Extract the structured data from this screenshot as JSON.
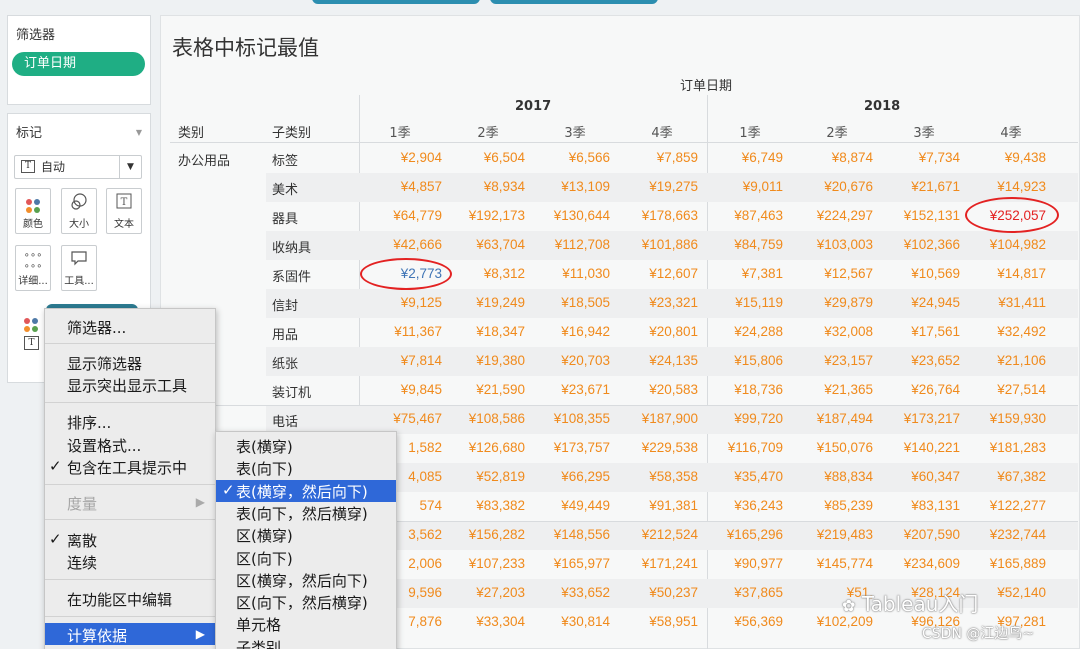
{
  "filters": {
    "title": "筛选器",
    "pill": "订单日期"
  },
  "marks": {
    "title": "标记",
    "type": "自动",
    "buttons": [
      {
        "label": "颜色",
        "icon": "color-dots-icon"
      },
      {
        "label": "大小",
        "icon": "size-icon"
      },
      {
        "label": "文本",
        "icon": "text-icon"
      },
      {
        "label": "详细...",
        "icon": "detail-icon"
      },
      {
        "label": "工具...",
        "icon": "tooltip-icon"
      }
    ]
  },
  "viz": {
    "title": "表格中标记最值",
    "column_header": "订单日期",
    "years": [
      "2017",
      "2018"
    ],
    "row_header_1": "类别",
    "row_header_2": "子类别",
    "quarters": [
      "1季",
      "2季",
      "3季",
      "4季",
      "1季",
      "2季",
      "3季",
      "4季"
    ],
    "category": "办公用品",
    "rows": [
      {
        "sub": "标签",
        "values": [
          "¥2,904",
          "¥6,504",
          "¥6,566",
          "¥7,859",
          "¥6,749",
          "¥8,874",
          "¥7,734",
          "¥9,438"
        ]
      },
      {
        "sub": "美术",
        "values": [
          "¥4,857",
          "¥8,934",
          "¥13,109",
          "¥19,275",
          "¥9,011",
          "¥20,676",
          "¥21,671",
          "¥14,923"
        ]
      },
      {
        "sub": "器具",
        "values": [
          "¥64,779",
          "¥192,173",
          "¥130,644",
          "¥178,663",
          "¥87,463",
          "¥224,297",
          "¥152,131",
          "¥252,057"
        ]
      },
      {
        "sub": "收纳具",
        "values": [
          "¥42,666",
          "¥63,704",
          "¥112,708",
          "¥101,886",
          "¥84,759",
          "¥103,003",
          "¥102,366",
          "¥104,982"
        ]
      },
      {
        "sub": "系固件",
        "values": [
          "¥2,773",
          "¥8,312",
          "¥11,030",
          "¥12,607",
          "¥7,381",
          "¥12,567",
          "¥10,569",
          "¥14,817"
        ]
      },
      {
        "sub": "信封",
        "values": [
          "¥9,125",
          "¥19,249",
          "¥18,505",
          "¥23,321",
          "¥15,119",
          "¥29,879",
          "¥24,945",
          "¥31,411"
        ]
      },
      {
        "sub": "用品",
        "values": [
          "¥11,367",
          "¥18,347",
          "¥16,942",
          "¥20,801",
          "¥24,288",
          "¥32,008",
          "¥17,561",
          "¥32,492"
        ]
      },
      {
        "sub": "纸张",
        "values": [
          "¥7,814",
          "¥19,380",
          "¥20,703",
          "¥24,135",
          "¥15,806",
          "¥23,157",
          "¥23,652",
          "¥21,106"
        ]
      },
      {
        "sub": "装订机",
        "values": [
          "¥9,845",
          "¥21,590",
          "¥23,671",
          "¥20,583",
          "¥18,736",
          "¥21,365",
          "¥26,764",
          "¥27,514"
        ]
      },
      {
        "sub": "电话",
        "values": [
          "¥75,467",
          "¥108,586",
          "¥108,355",
          "¥187,900",
          "¥99,720",
          "¥187,494",
          "¥173,217",
          "¥159,930"
        ]
      },
      {
        "sub": "",
        "values": [
          "1,582",
          "¥126,680",
          "¥173,757",
          "¥229,538",
          "¥116,709",
          "¥150,076",
          "¥140,221",
          "¥181,283"
        ]
      },
      {
        "sub": "",
        "values": [
          "4,085",
          "¥52,819",
          "¥66,295",
          "¥58,358",
          "¥35,470",
          "¥88,834",
          "¥60,347",
          "¥67,382"
        ]
      },
      {
        "sub": "",
        "values": [
          "574",
          "¥83,382",
          "¥49,449",
          "¥91,381",
          "¥36,243",
          "¥85,239",
          "¥83,131",
          "¥122,277"
        ]
      },
      {
        "sub": "",
        "values": [
          "3,562",
          "¥156,282",
          "¥148,556",
          "¥212,524",
          "¥165,296",
          "¥219,483",
          "¥207,590",
          "¥232,744"
        ]
      },
      {
        "sub": "",
        "values": [
          "2,006",
          "¥107,233",
          "¥165,977",
          "¥171,241",
          "¥90,977",
          "¥145,774",
          "¥234,609",
          "¥165,889"
        ]
      },
      {
        "sub": "",
        "values": [
          "9,596",
          "¥27,203",
          "¥33,652",
          "¥50,237",
          "¥37,865",
          "¥51,",
          "¥28,124",
          "¥52,140"
        ]
      },
      {
        "sub": "",
        "values": [
          "7,876",
          "¥33,304",
          "¥30,814",
          "¥58,951",
          "¥56,369",
          "¥102,209",
          "¥96,126",
          "¥97,281"
        ]
      }
    ],
    "min_color": "#3f74b5",
    "max_color": "#e32222",
    "value_color": "#f08a1c"
  },
  "context_menu": {
    "items": [
      {
        "label": "筛选器...",
        "state": "normal"
      },
      {
        "label": "显示筛选器",
        "state": "normal"
      },
      {
        "label": "显示突出显示工具",
        "state": "normal"
      },
      {
        "label": "排序...",
        "state": "normal"
      },
      {
        "label": "设置格式...",
        "state": "normal"
      },
      {
        "label": "包含在工具提示中",
        "state": "checked"
      },
      {
        "label": "度量",
        "state": "disabled"
      },
      {
        "label": "离散",
        "state": "checked"
      },
      {
        "label": "连续",
        "state": "normal"
      },
      {
        "label": "在功能区中编辑",
        "state": "normal"
      },
      {
        "label": "计算依据",
        "state": "selected"
      }
    ]
  },
  "submenu": {
    "items": [
      "表(横穿)",
      "表(向下)",
      "表(横穿，然后向下)",
      "表(向下，然后横穿)",
      "区(横穿)",
      "区(向下)",
      "区(横穿，然后向下)",
      "区(向下，然后横穿)",
      "单元格",
      "子类别"
    ],
    "checked_index": 2
  },
  "watermark": {
    "brand": "Tableau入门",
    "csdn": "CSDN @江边鸟~"
  }
}
